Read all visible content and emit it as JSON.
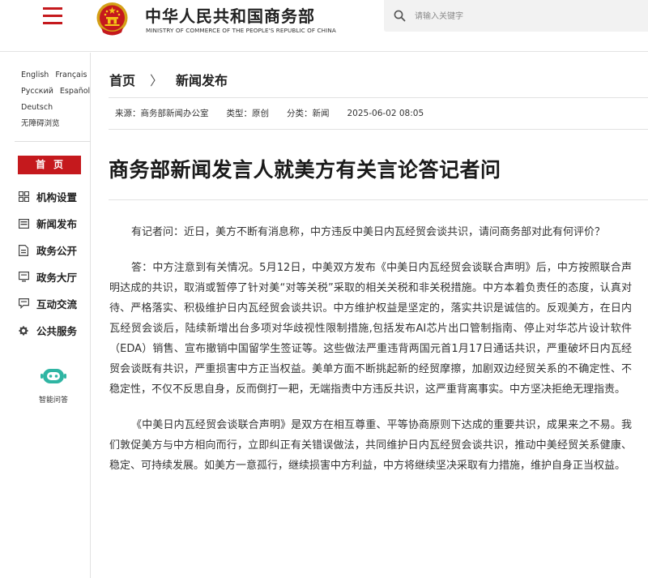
{
  "header": {
    "title_cn": "中华人民共和国商务部",
    "title_en": "MINISTRY OF COMMERCE OF THE PEOPLE'S REPUBLIC OF CHINA",
    "search_placeholder": "请输入关键字",
    "accent_color": "#c5191d"
  },
  "sidebar": {
    "languages": [
      [
        "English",
        "Français"
      ],
      [
        "Русский",
        "Español"
      ],
      [
        "Deutsch"
      ],
      [
        "无障碍浏览"
      ]
    ],
    "home_label": "首页",
    "items": [
      {
        "label": "机构设置",
        "icon": "org-grid-icon"
      },
      {
        "label": "新闻发布",
        "icon": "news-icon"
      },
      {
        "label": "政务公开",
        "icon": "document-icon"
      },
      {
        "label": "政务大厅",
        "icon": "monitor-icon"
      },
      {
        "label": "互动交流",
        "icon": "chat-icon"
      },
      {
        "label": "公共服务",
        "icon": "service-gear-icon"
      }
    ],
    "qa_label": "智能问答"
  },
  "breadcrumb": {
    "home": "首页",
    "separator": "〉",
    "current": "新闻发布"
  },
  "meta": {
    "source": "来源：商务部新闻办公室",
    "type": "类型：原创",
    "category": "分类：新闻",
    "datetime": "2025-06-02 08:05"
  },
  "article": {
    "title": "商务部新闻发言人就美方有关言论答记者问",
    "paragraphs": [
      "有记者问：近日，美方不断有消息称，中方违反中美日内瓦经贸会谈共识，请问商务部对此有何评价？",
      "答：中方注意到有关情况。5月12日，中美双方发布《中美日内瓦经贸会谈联合声明》后，中方按照联合声明达成的共识，取消或暂停了针对美“对等关税”采取的相关关税和非关税措施。中方本着负责任的态度，认真对待、严格落实、积极维护日内瓦经贸会谈共识。中方维护权益是坚定的，落实共识是诚信的。反观美方，在日内瓦经贸会谈后，陆续新增出台多项对华歧视性限制措施,包括发布AI芯片出口管制指南、停止对华芯片设计软件（EDA）销售、宣布撤销中国留学生签证等。这些做法严重违背两国元首1月17日通话共识，严重破坏日内瓦经贸会谈既有共识，严重损害中方正当权益。美单方面不断挑起新的经贸摩擦，加剧双边经贸关系的不确定性、不稳定性，不仅不反思自身，反而倒打一耙，无端指责中方违反共识，这严重背离事实。中方坚决拒绝无理指责。",
      "《中美日内瓦经贸会谈联合声明》是双方在相互尊重、平等协商原则下达成的重要共识，成果来之不易。我们敦促美方与中方相向而行，立即纠正有关错误做法，共同维护日内瓦经贸会谈共识，推动中美经贸关系健康、稳定、可持续发展。如美方一意孤行，继续损害中方利益，中方将继续坚决采取有力措施，维护自身正当权益。"
    ]
  }
}
